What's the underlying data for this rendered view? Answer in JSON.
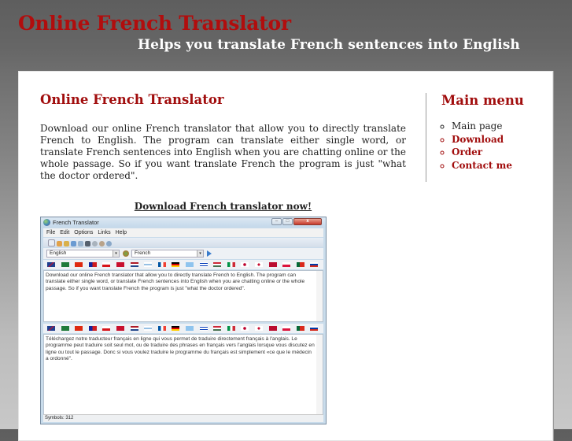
{
  "header": {
    "title": "Online French Translator",
    "tagline": "Helps you translate French sentences into English"
  },
  "main": {
    "title": "Online French Translator",
    "intro": "Download our online French translator that allow you to directly translate French to English. The program can translate either single word, or translate French sentences into English when you are chatting online or the whole passage. So if you want translate French the program is just \"what the doctor ordered\".",
    "download_link": "Download French translator now!"
  },
  "sidebar": {
    "title": "Main menu",
    "items": [
      {
        "label": "Main page",
        "active": true
      },
      {
        "label": "Download"
      },
      {
        "label": "Order"
      },
      {
        "label": "Contact me"
      }
    ]
  },
  "app_screenshot": {
    "window_title": "French Translator",
    "menu": [
      "File",
      "Edit",
      "Options",
      "Links",
      "Help"
    ],
    "toolbar_icons": [
      "new-icon",
      "open-icon",
      "save-icon",
      "search-icon",
      "speech-icon",
      "print-icon",
      "settings-icon",
      "help-icon",
      "info-icon"
    ],
    "source_language": "English",
    "target_language": "French",
    "flags": [
      "uk",
      "saudi-arabia",
      "china",
      "taiwan",
      "czech",
      "denmark",
      "netherlands",
      "finland",
      "france",
      "germany",
      "greece",
      "israel",
      "hungary",
      "italy",
      "japan",
      "korea",
      "norway",
      "poland",
      "portugal",
      "russia"
    ],
    "source_text": "Download our online French translator that allow you to directly translate French to English. The program can translate either single word, or translate French sentences into English when you are chatting online or the whole passage. So if you want translate French the program is just \"what the doctor ordered\".",
    "translated_text": "Téléchargez notre traducteur français en ligne qui vous permet de traduire directement français à l'anglais. Le programme peut traduire soit seul mot, ou de traduire des phrases en français vers l'anglais lorsque vous discutez en ligne ou tout le passage. Donc si vous voulez traduire le programme du français est simplement «ce que le médecin a ordonné\".",
    "status": "Symbols: 312"
  },
  "colors": {
    "accent": "#a10d0d",
    "title_red": "#b10d0d",
    "body_text": "#222222"
  }
}
